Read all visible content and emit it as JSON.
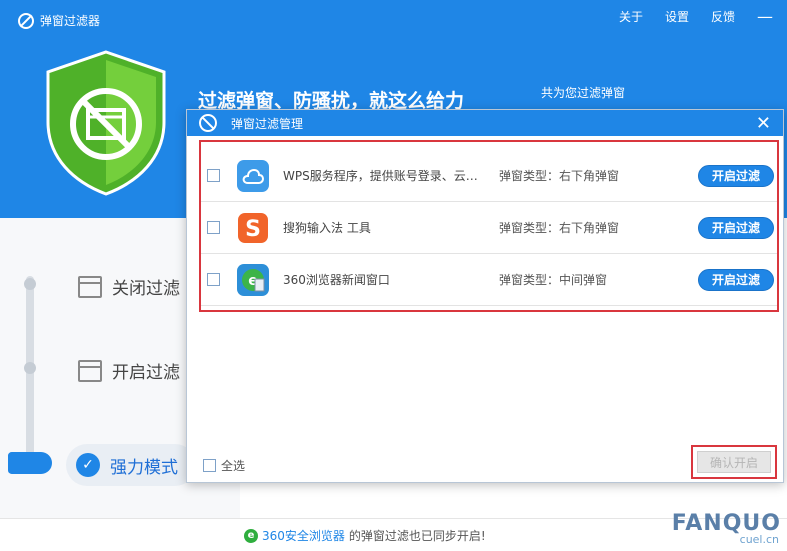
{
  "app": {
    "title": "弹窗过滤器",
    "menu": {
      "about": "关于",
      "settings": "设置",
      "feedback": "反馈"
    },
    "minimize_glyph": "—"
  },
  "hero": {
    "slogan": "过滤弹窗、防骚扰，就这么给力",
    "stat_text": "共为您过滤弹窗"
  },
  "modes": {
    "close": "关闭过滤",
    "open": "开启过滤",
    "strong": "强力模式"
  },
  "dialog": {
    "title": "弹窗过滤管理",
    "close_glyph": "✕",
    "rows": [
      {
        "name": "WPS服务程序，提供账号登录、云…",
        "type": "弹窗类型：右下角弹窗",
        "button": "开启过滤",
        "icon": "wps-cloud-icon"
      },
      {
        "name": "搜狗输入法 工具",
        "type": "弹窗类型：右下角弹窗",
        "button": "开启过滤",
        "icon": "sogou-icon"
      },
      {
        "name": "360浏览器新闻窗口",
        "type": "弹窗类型：中间弹窗",
        "button": "开启过滤",
        "icon": "360-browser-icon"
      }
    ],
    "select_all": "全选",
    "confirm": "确认开启"
  },
  "footer": {
    "browser_name": "360安全浏览器",
    "message": "的弹窗过滤也已同步开启!",
    "watermark": "FANQUO",
    "watermark_sub": "cuel.cn"
  },
  "colors": {
    "primary": "#1f86e6",
    "highlight_border": "#d9363e",
    "shield_green": "#5fc32c"
  }
}
